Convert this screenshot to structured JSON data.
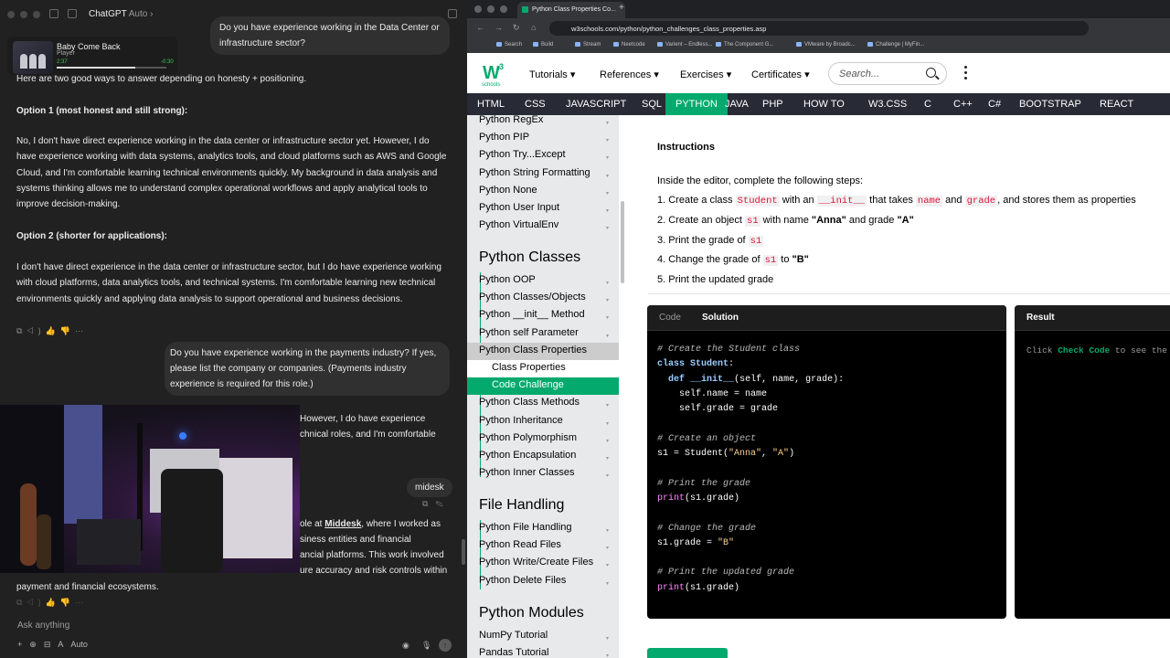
{
  "chat": {
    "app_title": "ChatGPT",
    "mode": "Auto",
    "player": {
      "title": "Baby Come Back",
      "artist": "Player",
      "elapsed": "2:37",
      "remaining": "-0:30",
      "progress": 0.72
    },
    "user_msg_1": "Do you have experience working in the Data Center or infrastructure sector?",
    "answer_intro": "Here are two good ways to answer depending on honesty + positioning.",
    "option1_heading": "Option 1 (most honest and still strong):",
    "option1_text": "No, I don't have direct experience working in the data center or infrastructure sector yet. However, I do have experience working with data systems, analytics tools, and cloud platforms such as AWS and Google Cloud, and I'm comfortable learning technical environments quickly. My background in data analysis and systems thinking allows me to understand complex operational workflows and apply analytical tools to improve decision-making.",
    "option2_heading": "Option 2 (shorter for applications):",
    "option2_text": "I don't have direct experience in the data center or infrastructure sector, but I do have experience working with cloud platforms, data analytics tools, and technical systems. I'm comfortable learning new technical environments quickly and applying data analysis to support operational and business decisions.",
    "user_msg_2": "Do you have experience working in the payments industry? If yes, please list the company or companies. (Payments industry experience is required for this role.)",
    "partial_1": "However, I do have experience",
    "partial_2": "chnical roles, and I'm comfortable",
    "user_msg_3": "midesk",
    "partial_3_pre": "ole at ",
    "partial_3_link": "Middesk",
    "partial_3_post": ", where I worked as",
    "partial_4": "siness entities and financial",
    "partial_5": "ancial platforms. This work involved",
    "partial_6": "ure accuracy and risk controls within",
    "partial_7": "payment and financial ecosystems.",
    "composer_placeholder": "Ask anything",
    "composer_mode": "Auto"
  },
  "browser": {
    "tab_title": "Python Class Properties Co...",
    "url": "w3schools.com/python/python_challenges_class_properties.asp",
    "bookmarks": [
      "Search",
      "Build",
      "Stream",
      "Neetcode",
      "Varient – Endless...",
      "The Component G...",
      "VMware by Broadc...",
      "Challenge | MyFin..."
    ]
  },
  "w3": {
    "logo_text": "W",
    "logo_sup": "3",
    "logo_sub": "schools",
    "nav": [
      "Tutorials",
      "References",
      "Exercises",
      "Certificates"
    ],
    "search_placeholder": "Search...",
    "langs": [
      "HTML",
      "CSS",
      "JAVASCRIPT",
      "SQL",
      "PYTHON",
      "JAVA",
      "PHP",
      "HOW TO",
      "W3.CSS",
      "C",
      "C++",
      "C#",
      "BOOTSTRAP",
      "REACT"
    ],
    "active_lang": "PYTHON",
    "sidebar": {
      "top_items": [
        "Python RegEx",
        "Python PIP",
        "Python Try...Except",
        "Python String Formatting",
        "Python None",
        "Python User Input",
        "Python VirtualEnv"
      ],
      "classes_heading": "Python Classes",
      "class_items": [
        "Python OOP",
        "Python Classes/Objects",
        "Python __init__ Method",
        "Python self Parameter",
        "Python Class Properties"
      ],
      "sub_items": [
        "Class Properties",
        "Code Challenge"
      ],
      "class_items_after": [
        "Python Class Methods",
        "Python Inheritance",
        "Python Polymorphism",
        "Python Encapsulation",
        "Python Inner Classes"
      ],
      "file_heading": "File Handling",
      "file_items": [
        "Python File Handling",
        "Python Read Files",
        "Python Write/Create Files",
        "Python Delete Files"
      ],
      "modules_heading": "Python Modules",
      "module_items": [
        "NumPy Tutorial",
        "Pandas Tutorial"
      ]
    },
    "instructions": {
      "title": "Instructions",
      "intro": "Inside the editor, complete the following steps:",
      "s1_a": "1. Create a class ",
      "s1_code1": "Student",
      "s1_b": " with an ",
      "s1_code2": "__init__",
      "s1_c": " that takes ",
      "s1_code3": "name",
      "s1_d": " and ",
      "s1_code4": "grade",
      "s1_e": ", and stores them as properties",
      "s2_a": "2. Create an object ",
      "s2_code": "s1",
      "s2_b": " with name ",
      "s2_bold1": "\"Anna\"",
      "s2_c": " and grade ",
      "s2_bold2": "\"A\"",
      "s3_a": "3. Print the grade of ",
      "s3_code": "s1",
      "s4_a": "4. Change the grade of ",
      "s4_code": "s1",
      "s4_b": " to ",
      "s4_bold": "\"B\"",
      "s5": "5. Print the updated grade"
    },
    "editor": {
      "tab_code": "Code",
      "tab_solution": "Solution",
      "comment1": "# Create the Student class",
      "comment2": "# Create an object",
      "comment3": "# Print the grade",
      "comment4": "# Change the grade",
      "comment5": "# Print the updated grade"
    },
    "result": {
      "title": "Result",
      "hint_pre": "Click ",
      "hint_bold": "Check Code",
      "hint_post": " to see the"
    }
  }
}
